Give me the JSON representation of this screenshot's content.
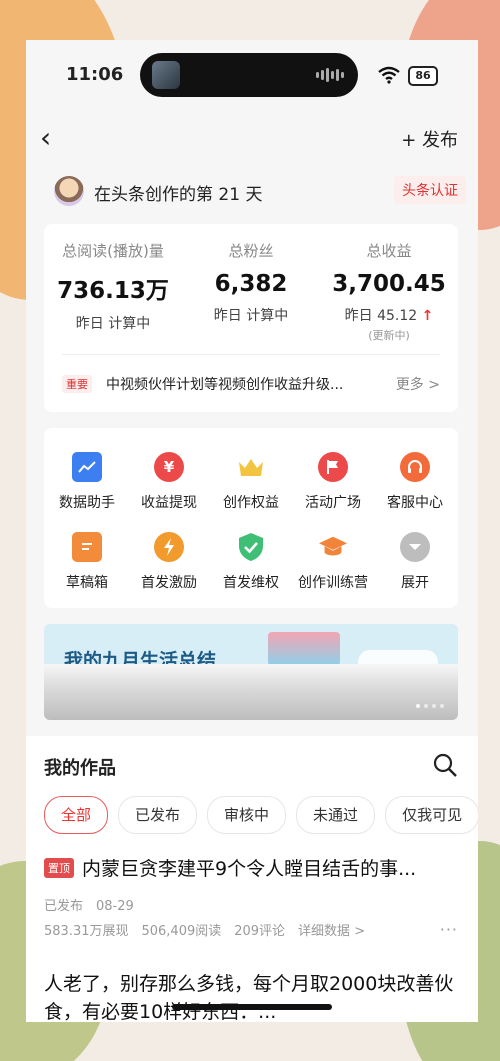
{
  "status_bar": {
    "time": "11:06",
    "battery": "86"
  },
  "nav": {
    "back_icon": "chevron-left-icon",
    "publish_label": "+ 发布"
  },
  "profile": {
    "days_text": "在头条创作的第 21 天",
    "certify_label": "头条认证"
  },
  "stats": [
    {
      "label": "总阅读(播放)量",
      "value": "736.13万",
      "sub": "昨日 计算中"
    },
    {
      "label": "总粉丝",
      "value": "6,382",
      "sub": "昨日 计算中"
    },
    {
      "label": "总收益",
      "value": "3,700.45",
      "sub": "昨日 45.12",
      "trend": "↑",
      "note": "(更新中)"
    }
  ],
  "notice": {
    "tag": "重要",
    "text": "中视频伙伴计划等视频创作收益升级...",
    "more": "更多 >"
  },
  "tools": [
    {
      "label": "数据助手",
      "icon": "chart-icon",
      "color": "#3d7ff0"
    },
    {
      "label": "收益提现",
      "icon": "yen-icon",
      "color": "#ec4a4a"
    },
    {
      "label": "创作权益",
      "icon": "crown-icon",
      "color": "#f3c43f"
    },
    {
      "label": "活动广场",
      "icon": "flag-icon",
      "color": "#ec4a4a"
    },
    {
      "label": "客服中心",
      "icon": "headset-icon",
      "color": "#f36b3b"
    },
    {
      "label": "草稿箱",
      "icon": "draft-icon",
      "color": "#f28c3a"
    },
    {
      "label": "首发激励",
      "icon": "lightning-icon",
      "color": "#f39a2d"
    },
    {
      "label": "首发维权",
      "icon": "shield-check-icon",
      "color": "#3fbf75"
    },
    {
      "label": "创作训练营",
      "icon": "graduation-cap-icon",
      "color": "#f2843a"
    },
    {
      "label": "展开",
      "icon": "chevron-down-icon",
      "color": "#bdbdbd"
    }
  ],
  "banner": {
    "text": "我的九月生活总结"
  },
  "works": {
    "title": "我的作品",
    "tabs": [
      "全部",
      "已发布",
      "审核中",
      "未通过",
      "仅我可见"
    ],
    "article1": {
      "pin": "置顶",
      "title": "内蒙巨贪李建平9个令人瞠目结舌的事...",
      "status": "已发布　08-29",
      "stats": "583.31万展现　506,409阅读　209评论　详细数据 >",
      "more": "···"
    },
    "article2_text": "人老了，别存那么多钱，每个月取2000块改善伙食，有必要10样好东西：..."
  }
}
